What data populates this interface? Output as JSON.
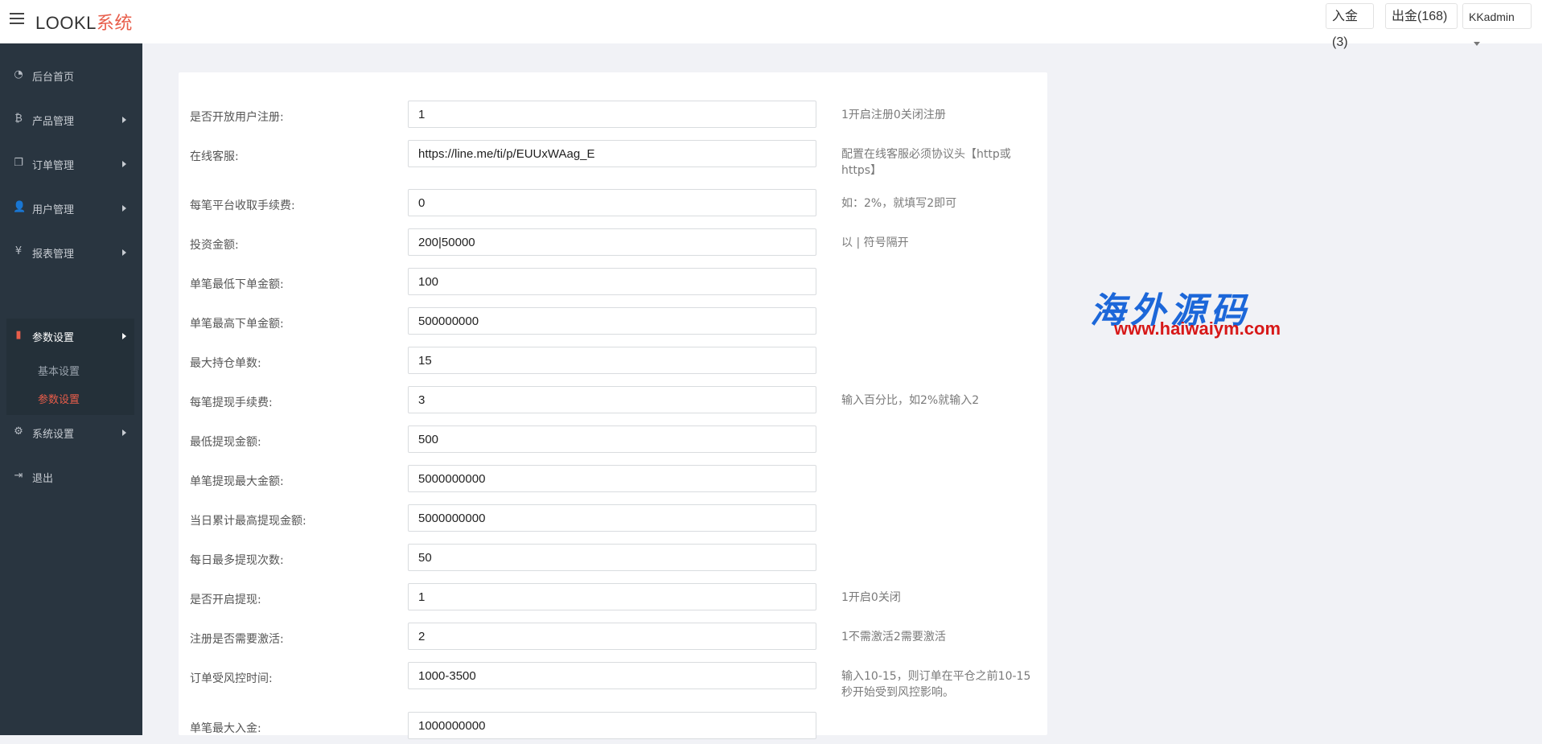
{
  "header": {
    "brand_main": "LOOKL",
    "brand_accent": "系统",
    "deposit_btn": "入金(3)",
    "withdraw_btn": "出金(168)",
    "admin_btn": "KKadmin"
  },
  "sidebar": {
    "items": [
      {
        "label": "后台首页",
        "icon": "dashboard-icon",
        "glyph": "◔"
      },
      {
        "label": "产品管理",
        "icon": "bitcoin-icon",
        "glyph": "₿"
      },
      {
        "label": "订单管理",
        "icon": "copy-icon",
        "glyph": "❐"
      },
      {
        "label": "用户管理",
        "icon": "user-icon",
        "glyph": "👤"
      },
      {
        "label": "报表管理",
        "icon": "yen-icon",
        "glyph": "¥"
      },
      {
        "label": "参数设置",
        "icon": "file-icon",
        "glyph": "▮"
      },
      {
        "label": "系统设置",
        "icon": "cogs-icon",
        "glyph": "⚙"
      },
      {
        "label": "退出",
        "icon": "sign-out-icon",
        "glyph": "⇥"
      }
    ],
    "sub_items": [
      {
        "label": "基本设置"
      },
      {
        "label": "参数设置"
      }
    ]
  },
  "form": {
    "rows": [
      {
        "label": "是否开放用户注册:",
        "value": "1",
        "help": "1开启注册0关闭注册"
      },
      {
        "label": "在线客服:",
        "value": "https://line.me/ti/p/EUUxWAag_E",
        "help": "配置在线客服必须协议头【http或https】"
      },
      {
        "label": "每笔平台收取手续费:",
        "value": "0",
        "help": "如：2%，就填写2即可"
      },
      {
        "label": "投资金额:",
        "value": "200|50000",
        "help": "以 | 符号隔开"
      },
      {
        "label": "单笔最低下单金额:",
        "value": "100",
        "help": ""
      },
      {
        "label": "单笔最高下单金额:",
        "value": "500000000",
        "help": ""
      },
      {
        "label": "最大持仓单数:",
        "value": "15",
        "help": ""
      },
      {
        "label": "每笔提现手续费:",
        "value": "3",
        "help": "输入百分比，如2%就输入2"
      },
      {
        "label": "最低提现金额:",
        "value": "500",
        "help": ""
      },
      {
        "label": "单笔提现最大金额:",
        "value": "5000000000",
        "help": ""
      },
      {
        "label": "当日累计最高提现金额:",
        "value": "5000000000",
        "help": ""
      },
      {
        "label": "每日最多提现次数:",
        "value": "50",
        "help": ""
      },
      {
        "label": "是否开启提现:",
        "value": "1",
        "help": "1开启0关闭"
      },
      {
        "label": "注册是否需要激活:",
        "value": "2",
        "help": "1不需激活2需要激活"
      },
      {
        "label": "订单受风控时间:",
        "value": "1000-3500",
        "help": "输入10-15，则订单在平仓之前10-15秒开始受到风控影响。"
      },
      {
        "label": "单笔最大入金:",
        "value": "1000000000",
        "help": ""
      }
    ]
  },
  "watermark": {
    "text": "海外源码",
    "url": "www.haiwaiym.com"
  }
}
